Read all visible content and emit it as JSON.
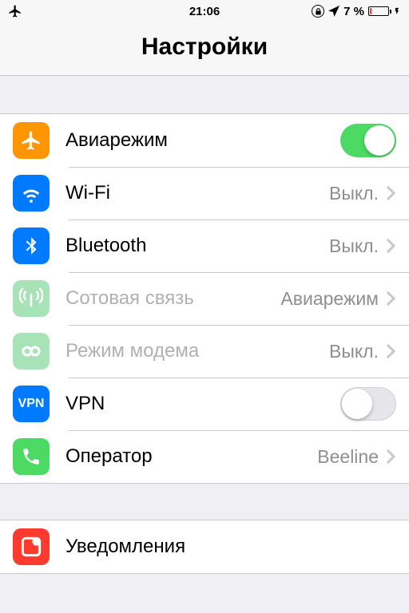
{
  "status": {
    "time": "21:06",
    "battery_pct": "7 %"
  },
  "header": {
    "title": "Настройки"
  },
  "group1": {
    "airplane": {
      "label": "Авиарежим"
    },
    "wifi": {
      "label": "Wi-Fi",
      "value": "Выкл."
    },
    "bluetooth": {
      "label": "Bluetooth",
      "value": "Выкл."
    },
    "cellular": {
      "label": "Сотовая связь",
      "value": "Авиарежим"
    },
    "hotspot": {
      "label": "Режим модема",
      "value": "Выкл."
    },
    "vpn": {
      "label": "VPN",
      "tile_text": "VPN"
    },
    "carrier": {
      "label": "Оператор",
      "value": "Beeline"
    }
  },
  "group2": {
    "notifications": {
      "label": "Уведомления"
    }
  }
}
